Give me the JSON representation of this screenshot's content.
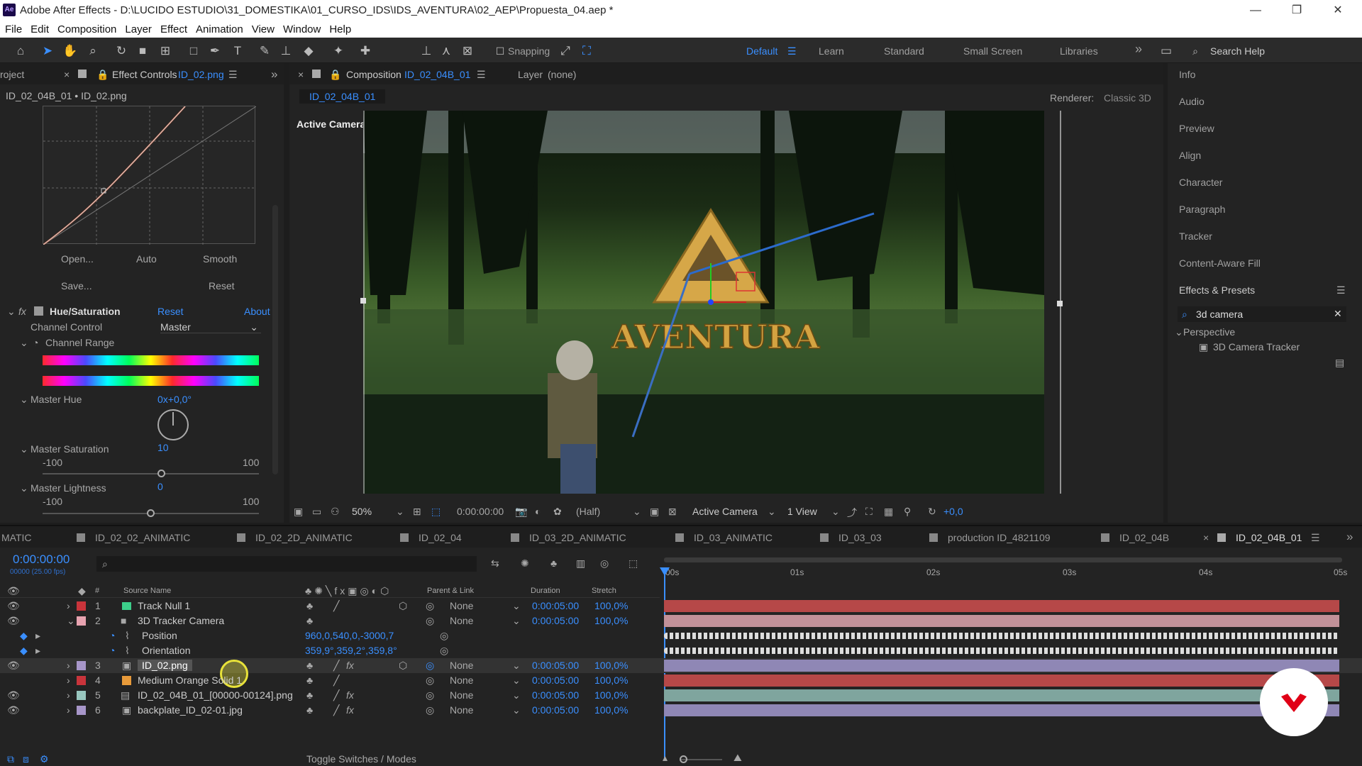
{
  "window": {
    "title": "Adobe After Effects - D:\\LUCIDO ESTUDIO\\31_DOMESTIKA\\01_CURSO_IDS\\IDS_AVENTURA\\02_AEP\\Propuesta_04.aep *",
    "logo": "Ae",
    "minimize": "—",
    "maximize": "❐",
    "close": "✕"
  },
  "menu": [
    "File",
    "Edit",
    "Composition",
    "Layer",
    "Effect",
    "Animation",
    "View",
    "Window",
    "Help"
  ],
  "toolbar": {
    "snapping_label": "Snapping",
    "workspaces": [
      "Default",
      "Learn",
      "Standard",
      "Small Screen",
      "Libraries"
    ],
    "active_workspace": "Default",
    "more": "»",
    "search_placeholder": "Search Help"
  },
  "left_panel": {
    "project_tab": "roject",
    "effect_controls_prefix": "Effect Controls",
    "effect_controls_file": "ID_02.png",
    "layer_path": "ID_02_04B_01 • ID_02.png",
    "curve_buttons": {
      "open": "Open...",
      "auto": "Auto",
      "smooth": "Smooth",
      "save": "Save...",
      "reset": "Reset"
    },
    "effect": {
      "name": "Hue/Saturation",
      "reset": "Reset",
      "about": "About",
      "channel_control_label": "Channel Control",
      "channel_control_value": "Master",
      "channel_range_label": "Channel Range",
      "master_hue_label": "Master Hue",
      "master_hue_value": "0x+0,0°",
      "master_saturation_label": "Master Saturation",
      "master_saturation_value": "10",
      "sat_min": "-100",
      "sat_max": "100",
      "master_saturation_fraction": 0.55,
      "master_lightness_label": "Master Lightness",
      "master_lightness_value": "0",
      "light_min": "-100",
      "light_max": "100",
      "master_lightness_fraction": 0.5
    }
  },
  "composition": {
    "tab_prefix": "Composition",
    "tab_name": "ID_02_04B_01",
    "layer_label": "Layer",
    "layer_value": "(none)",
    "subtab": "ID_02_04B_01",
    "renderer_label": "Renderer:",
    "renderer_value": "Classic 3D",
    "active_camera_label": "Active Camera",
    "logo_text": "AVENTURA",
    "footer": {
      "zoom": "50%",
      "timecode": "0:00:00:00",
      "resolution": "(Half)",
      "camera": "Active Camera",
      "views": "1 View",
      "exposure": "+0,0"
    }
  },
  "right_panel": {
    "items": [
      "Info",
      "Audio",
      "Preview",
      "Align",
      "Character",
      "Paragraph",
      "Tracker",
      "Content-Aware Fill"
    ],
    "effects_presets": "Effects & Presets",
    "search_value": "3d camera",
    "category": "Perspective",
    "result": "3D Camera Tracker"
  },
  "timeline": {
    "tabs": [
      "MATIC",
      "ID_02_02_ANIMATIC",
      "ID_02_2D_ANIMATIC",
      "ID_02_04",
      "ID_03_2D_ANIMATIC",
      "ID_03_ANIMATIC",
      "ID_03_03",
      "production ID_4821109",
      "ID_02_04B",
      "ID_02_04B_01"
    ],
    "active_tab": "ID_02_04B_01",
    "timecode": "0:00:00:00",
    "fps": "00000 (25.00 fps)",
    "columns": {
      "num": "#",
      "source_name": "Source Name",
      "parent": "Parent & Link",
      "duration": "Duration",
      "stretch": "Stretch"
    },
    "ruler": [
      "00s",
      "01s",
      "02s",
      "03s",
      "04s",
      "05s"
    ],
    "layers": [
      {
        "num": "1",
        "name": "Track Null 1",
        "color": "#c9343b",
        "parent": "None",
        "duration": "0:00:05:00",
        "stretch": "100,0%",
        "bar": "#b64848"
      },
      {
        "num": "2",
        "name": "3D Tracker Camera",
        "color": "#e7a3b0",
        "parent": "None",
        "duration": "0:00:05:00",
        "stretch": "100,0%",
        "bar": "#c29199"
      },
      {
        "num": "3",
        "name": "ID_02.png",
        "color": "#a796c9",
        "parent": "None",
        "duration": "0:00:05:00",
        "stretch": "100,0%",
        "bar": "#8f87b5"
      },
      {
        "num": "4",
        "name": "Medium Orange Solid 1",
        "color": "#c9343b",
        "parent": "None",
        "duration": "0:00:05:00",
        "stretch": "100,0%",
        "bar": "#b64848"
      },
      {
        "num": "5",
        "name": "ID_02_04B_01_[00000-00124].png",
        "color": "#98c6be",
        "parent": "None",
        "duration": "0:00:05:00",
        "stretch": "100,0%",
        "bar": "#7fa59e"
      },
      {
        "num": "6",
        "name": "backplate_ID_02-01.jpg",
        "color": "#a796c9",
        "parent": "None",
        "duration": "0:00:05:00",
        "stretch": "100,0%",
        "bar": "#8f87b5"
      }
    ],
    "position_label": "Position",
    "position_value": "960,0,540,0,-3000,7",
    "orientation_label": "Orientation",
    "orientation_value": "359,9°,359,2°,359,8°",
    "toggle_label": "Toggle Switches / Modes"
  },
  "colors": {
    "accent": "#3a8fff",
    "panel": "#232323",
    "background": "#1d1d1d"
  }
}
